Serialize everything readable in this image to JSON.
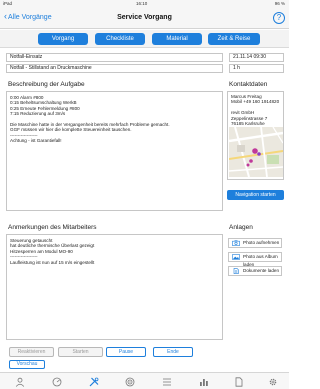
{
  "statusbar": {
    "carrier": "iPad",
    "time": "16:10",
    "battery": "96 %"
  },
  "navbar": {
    "back_label": "Alle Vorgänge",
    "title": "Service Vorgang",
    "help_label": "?"
  },
  "tabs": [
    {
      "label": "Vorgang"
    },
    {
      "label": "Checkliste"
    },
    {
      "label": "Material"
    },
    {
      "label": "Zeit & Reise"
    }
  ],
  "fields": {
    "emergency": "Notfall-Einsatz",
    "description": "Notfall - Stillstand an Druckmaschine",
    "date": "21.11.14 09:30",
    "duration": "1 h"
  },
  "task": {
    "title": "Beschreibung der Aufgabe",
    "lines": [
      "0:00 Alarm #800",
      "0:15 Beheltsumschaltung WerkB",
      "0:25 Erneute Fehlermeldung #800",
      "7:15 Reduzierung auf 3m/s",
      "",
      "Die Maschine hatte in der Vergangenheit bereits mehrfach Probleme gemacht.",
      "GGF müssen wir hier die komplette Steuereinheit tauschen.",
      "------------------",
      "Achtung - ist Garantiefall!"
    ]
  },
  "contact": {
    "title": "Kontaktdaten",
    "lines": [
      "Marcus Freitag",
      "Mobil +49 160 1914820",
      "",
      "revit GmbH",
      "Zeppelinstrasse 7",
      "76185 Karlsruhe"
    ],
    "nav_button": "Navigation starten"
  },
  "notes": {
    "title": "Anmerkungen des Mitarbeiters",
    "lines": [
      "Steuerung getauscht",
      "hat deutliche thermische Überlast gezeigt",
      "Hitzesperren am Modul MO-90",
      "------------------",
      "Laufleistung ist nun auf 15 m/s eingestellt"
    ]
  },
  "attachments": {
    "title": "Anlagen",
    "items": [
      {
        "label": "Photo aufnehmen",
        "icon": "camera-icon"
      },
      {
        "label": "Photo aus Album laden",
        "icon": "photo-album-icon"
      },
      {
        "label": "Dokumente laden",
        "icon": "document-icon"
      }
    ]
  },
  "actions": {
    "reactivate": "Reaktivieren",
    "start": "Starten",
    "pause": "Pause",
    "end": "Ende",
    "preview": "Vorschau"
  },
  "colors": {
    "accent": "#1e7fdc"
  }
}
